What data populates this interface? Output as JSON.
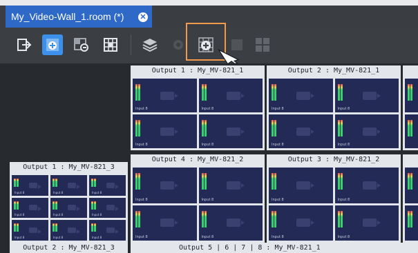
{
  "tab": {
    "title": "My_Video-Wall_1.room (*)",
    "close_glyph": "✕"
  },
  "toolbar": {
    "buttons": [
      {
        "icon": "exit-icon"
      },
      {
        "icon": "add-monitor-icon"
      },
      {
        "icon": "link-layout-icon"
      },
      {
        "icon": "grid-icon"
      },
      {
        "icon": "layers-icon"
      },
      {
        "icon": "disabled-settings-icon"
      },
      {
        "icon": "add-grid-icon"
      },
      {
        "icon": "disabled-monitor-icon"
      },
      {
        "icon": "tiles-icon"
      }
    ]
  },
  "monitors": {
    "output1_top": "Output 1 : My_MV-821_1",
    "output2_top": "Output 2 : My_MV-821_1",
    "output3_top": "Output 3 : My_MV-821_2",
    "output4_top": "Output 4 : My_MV-821_2",
    "output1_left": "Output 1 : My_MV-821_3",
    "output2_left": "Output 2 : My_MV-821_3",
    "output5_bottom": "Output 5 | 6 | 7 | 8 : My_MV-821_1"
  },
  "tile_label": "Input 8",
  "colors": {
    "accent": "#2f69c7",
    "highlight": "#f39a4d"
  }
}
